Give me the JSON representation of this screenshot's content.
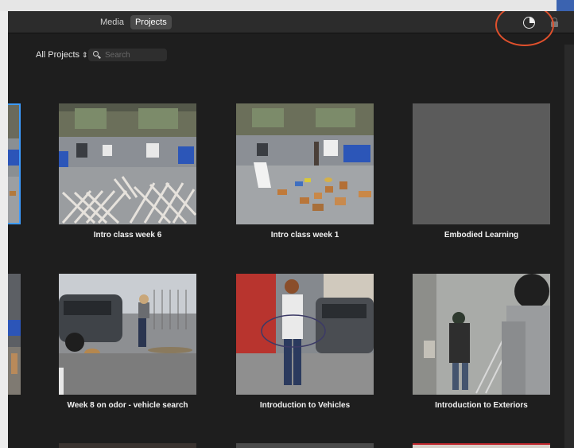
{
  "toolbar": {
    "tabs": [
      {
        "label": "Media",
        "active": false
      },
      {
        "label": "Projects",
        "active": true
      }
    ],
    "progress_icon": "progress-pie-icon",
    "lock_icon": "lock-icon"
  },
  "filter": {
    "selected": "All Projects",
    "search_placeholder": "Search",
    "search_value": ""
  },
  "projects": [
    {
      "title": "Intro class week 6",
      "thumbnail": "gym-with-fence-panels"
    },
    {
      "title": "Intro class week 1",
      "thumbnail": "gym-with-boxes"
    },
    {
      "title": "Embodied Learning",
      "thumbnail": "blank-gray"
    },
    {
      "title": "Week 8 on odor - vehicle search",
      "thumbnail": "parking-lot-dog"
    },
    {
      "title": "Introduction to Vehicles",
      "thumbnail": "woman-with-leash"
    },
    {
      "title": "Introduction to Exteriors",
      "thumbnail": "women-outside-building"
    }
  ],
  "colors": {
    "window_bg": "#1e1e1e",
    "toolbar_bg": "#2c2c2c",
    "selection": "#3d9bff",
    "annotation": "#e0502c"
  }
}
